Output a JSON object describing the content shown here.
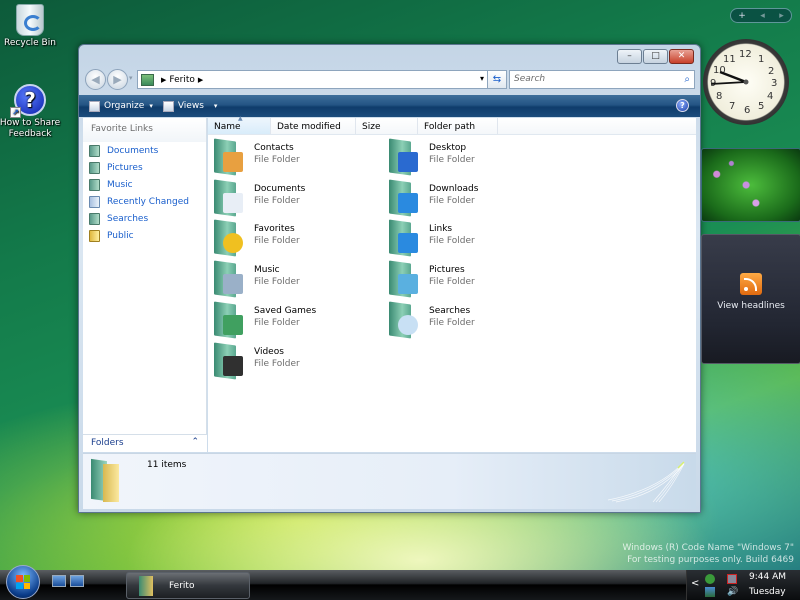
{
  "desktop": {
    "icons": [
      {
        "label": "Recycle Bin",
        "icon": "recycle-bin-icon"
      },
      {
        "label": "How to Share Feedback",
        "icon": "help-icon"
      }
    ],
    "watermark": {
      "line1": "Windows (R) Code Name \"Windows 7\"",
      "line2": "For testing purposes only. Build 6469"
    }
  },
  "window": {
    "title": "Ferito",
    "caption_buttons": {
      "minimize": "–",
      "maximize": "□",
      "close": "✕"
    },
    "nav": {
      "back": "◀",
      "forward": "▶",
      "dropdown": "▾"
    },
    "address": {
      "segments": [
        "Ferito"
      ],
      "dropdown_glyph": "▾"
    },
    "refresh_glyph": "⇆",
    "search": {
      "placeholder": "Search",
      "icon_glyph": "⌕"
    },
    "toolbar": {
      "organize_label": "Organize",
      "views_label": "Views",
      "caret": "▾",
      "help_glyph": "?"
    },
    "navpane": {
      "header": "Favorite Links",
      "items": [
        {
          "label": "Documents"
        },
        {
          "label": "Pictures"
        },
        {
          "label": "Music"
        },
        {
          "label": "Recently Changed"
        },
        {
          "label": "Searches"
        },
        {
          "label": "Public"
        }
      ],
      "folders_label": "Folders",
      "folders_toggle": "⌃"
    },
    "columns": [
      {
        "label": "Name",
        "sorted": true
      },
      {
        "label": "Date modified"
      },
      {
        "label": "Size"
      },
      {
        "label": "Folder path"
      }
    ],
    "items": [
      {
        "name": "Contacts",
        "type": "File Folder",
        "badge": "contacts"
      },
      {
        "name": "Desktop",
        "type": "File Folder",
        "badge": "desktop"
      },
      {
        "name": "Documents",
        "type": "File Folder",
        "badge": "documents"
      },
      {
        "name": "Downloads",
        "type": "File Folder",
        "badge": "downloads"
      },
      {
        "name": "Favorites",
        "type": "File Folder",
        "badge": "favorites"
      },
      {
        "name": "Links",
        "type": "File Folder",
        "badge": "links"
      },
      {
        "name": "Music",
        "type": "File Folder",
        "badge": "music"
      },
      {
        "name": "Pictures",
        "type": "File Folder",
        "badge": "pictures"
      },
      {
        "name": "Saved Games",
        "type": "File Folder",
        "badge": "saved-games"
      },
      {
        "name": "Searches",
        "type": "File Folder",
        "badge": "searches"
      },
      {
        "name": "Videos",
        "type": "File Folder",
        "badge": "videos"
      }
    ],
    "details": {
      "count": "11 items"
    }
  },
  "gadgets": {
    "sidebar_controls": {
      "add": "+",
      "prev": "◂",
      "next": "▸"
    },
    "clock": {
      "time": "9:44"
    },
    "feed": {
      "label": "View headlines"
    }
  },
  "taskbar": {
    "tasks": [
      {
        "label": "Ferito"
      }
    ],
    "tray": {
      "expand": "<",
      "time": "9:44 AM",
      "day": "Tuesday"
    }
  },
  "colors": {
    "link": "#1a5fcc",
    "toolbar": "#245484",
    "close": "#c8402a"
  }
}
